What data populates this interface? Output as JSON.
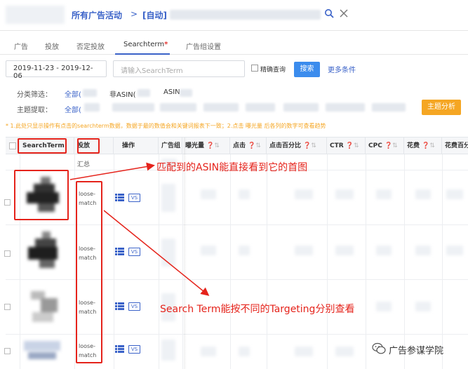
{
  "header": {
    "breadcrumb_all": "所有广告活动",
    "separator": ">",
    "breadcrumb_auto": "[自动]"
  },
  "tabs": [
    {
      "label": "广告"
    },
    {
      "label": "投放"
    },
    {
      "label": "否定投放"
    },
    {
      "label": "Searchterm",
      "marker": "*"
    },
    {
      "label": "广告组设置"
    }
  ],
  "filters": {
    "date_range": "2019-11-23 - 2019-12-06",
    "search_placeholder": "请输入SearchTerm",
    "exact_label": "精确查询",
    "search_button": "搜索",
    "more_conditions": "更多条件",
    "category_label": "分类筛选：",
    "category_options": [
      "全部(",
      "非ASIN(",
      "ASIN"
    ],
    "topic_label": "主题提取：",
    "topic_all": "全部(",
    "theme_button": "主题分析",
    "hint": "* 1.此处只显示操作有点击的searchterm数据，数据于最的数值会和关键词报表下一致；2.点击 曝光量 后各列的数字可查看趋势"
  },
  "table": {
    "columns": [
      "SearchTerm",
      "投放",
      "操作",
      "广告组",
      "曝光量",
      "点击",
      "点击百分比",
      "CTR",
      "CPC",
      "花费",
      "花费百分"
    ],
    "summary_label": "汇总",
    "rows": [
      {
        "targeting": "loose-match"
      },
      {
        "targeting": "loose-match"
      },
      {
        "targeting": "loose-match"
      },
      {
        "targeting": "loose-match"
      }
    ],
    "vs_label": "VS"
  },
  "annotations": {
    "asin_note": "匹配到的ASIN能直接看到它的首图",
    "targeting_note": "Search Term能按不同的Targeting分别查看",
    "color": "#e5231b"
  },
  "watermark": {
    "text": "广告参谋学院"
  },
  "colors": {
    "brand_blue": "#3a62c8",
    "search_button": "#3b8ced",
    "theme_button": "#f5a623",
    "hint": "#f5a623"
  }
}
